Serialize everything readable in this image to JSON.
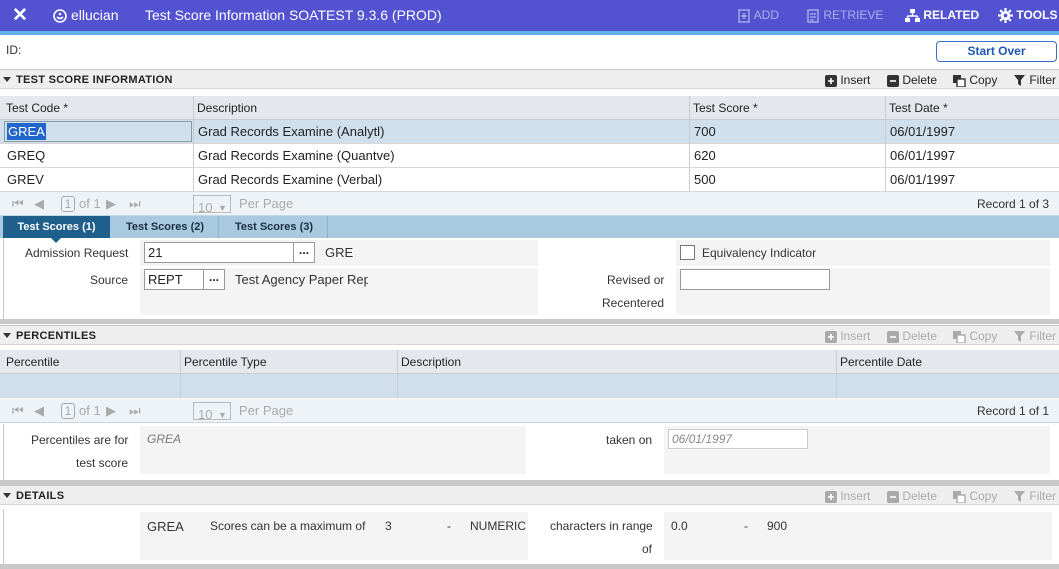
{
  "topbar": {
    "logo": "ellucian",
    "title": "Test Score Information SOATEST 9.3.6 (PROD)",
    "add": "ADD",
    "retrieve": "RETRIEVE",
    "related": "RELATED",
    "tools": "TOOLS"
  },
  "key": {
    "id_label": "ID:",
    "start_over": "Start Over"
  },
  "tools": {
    "insert": "Insert",
    "delete": "Delete",
    "copy": "Copy",
    "filter": "Filter"
  },
  "test_score": {
    "title": "TEST SCORE INFORMATION",
    "columns": [
      "Test Code *",
      "Description",
      "Test Score *",
      "Test Date *"
    ],
    "rows": [
      {
        "code": "GREA",
        "description": "Grad Records Examine (Analytl)",
        "score": "700",
        "date": "06/01/1997"
      },
      {
        "code": "GREQ",
        "description": "Grad Records Examine (Quantve)",
        "score": "620",
        "date": "06/01/1997"
      },
      {
        "code": "GREV",
        "description": "Grad Records Examine (Verbal)",
        "score": "500",
        "date": "06/01/1997"
      }
    ],
    "pager": {
      "page": "1",
      "of": "of 1",
      "per_page_value": "10",
      "per_page": "Per Page",
      "record": "Record 1 of 3"
    }
  },
  "tabs": [
    "Test Scores (1)",
    "Test Scores (2)",
    "Test Scores (3)"
  ],
  "form": {
    "admission_label": "Admission Request",
    "admission_value": "21",
    "admission_desc": "GRE",
    "source_label": "Source",
    "source_value": "REPT",
    "source_desc": "Test Agency Paper Rep",
    "equivalency_label": "Equivalency Indicator",
    "revised_label_1": "Revised or",
    "revised_label_2": "Recentered",
    "revised_value": ""
  },
  "percentiles": {
    "title": "PERCENTILES",
    "columns": [
      "Percentile",
      "Percentile Type",
      "Description",
      "Percentile Date"
    ],
    "pager": {
      "page": "1",
      "of": "of 1",
      "per_page_value": "10",
      "per_page": "Per Page",
      "record": "Record 1 of 1"
    },
    "for_label_1": "Percentiles are for",
    "for_label_2": "test score",
    "for_value": "GREA",
    "taken_label": "taken on",
    "taken_value": "06/01/1997"
  },
  "details": {
    "title": "DETAILS",
    "code": "GREA",
    "max_text": "Scores can be a maximum of",
    "max_value": "3",
    "dash1": "-",
    "type": "NUMERIC",
    "range_label_1": "characters in range",
    "range_label_2": "of",
    "range_min": "0.0",
    "dash2": "-",
    "range_max": "900"
  }
}
